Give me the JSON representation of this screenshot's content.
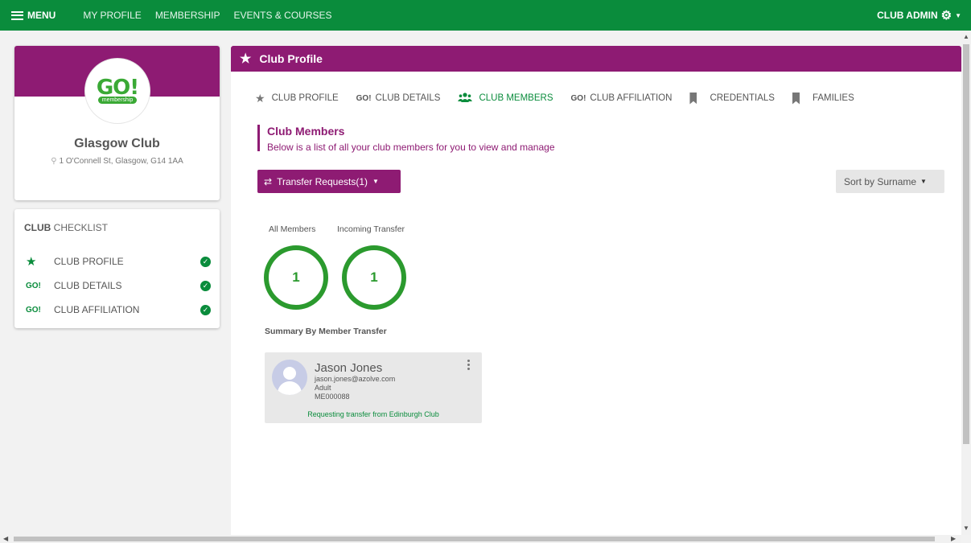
{
  "topnav": {
    "menu_label": "MENU",
    "links": [
      "MY PROFILE",
      "MEMBERSHIP",
      "EVENTS & COURSES"
    ],
    "user_label": "CLUB ADMIN"
  },
  "profile": {
    "logo_text": "GO!",
    "logo_sub": "membership",
    "club_name": "Glasgow Club",
    "address": "1 O'Connell St, Glasgow, G14 1AA"
  },
  "checklist": {
    "title_bold": "CLUB",
    "title_rest": " CHECKLIST",
    "items": [
      {
        "label": "CLUB PROFILE",
        "icon": "star-icon",
        "done": true
      },
      {
        "label": "CLUB DETAILS",
        "icon": "go-icon",
        "go_text": "GO!",
        "done": true
      },
      {
        "label": "CLUB AFFILIATION",
        "icon": "go-icon",
        "go_text": "GO!",
        "done": true
      }
    ]
  },
  "main": {
    "header_title": "Club Profile",
    "tabs": [
      {
        "label": "CLUB PROFILE",
        "icon": "star-icon"
      },
      {
        "label": "CLUB DETAILS",
        "icon": "go-icon",
        "go_text": "GO!"
      },
      {
        "label": "CLUB MEMBERS",
        "icon": "users-icon",
        "active": true
      },
      {
        "label": "CLUB AFFILIATION",
        "icon": "go-icon",
        "go_text": "GO!"
      },
      {
        "label": "CREDENTIALS",
        "icon": "bookmark-icon"
      },
      {
        "label": "FAMILIES",
        "icon": "bookmark-icon"
      }
    ],
    "section_title": "Club Members",
    "section_subtitle": "Below is a list of all your club members for you to view and manage",
    "transfer_button": "Transfer Requests(1)",
    "sort_button": "Sort by Surname",
    "stats": [
      {
        "label": "All Members",
        "value": "1"
      },
      {
        "label": "Incoming Transfer",
        "value": "1"
      }
    ],
    "summary_title": "Summary By Member Transfer",
    "member": {
      "name": "Jason Jones",
      "email": "jason.jones@azolve.com",
      "category": "Adult",
      "id": "ME000088",
      "status": "Requesting transfer from Edinburgh Club"
    }
  },
  "colors": {
    "nav_green": "#0a8c3c",
    "brand_purple": "#8e1b73",
    "ring_green": "#2b9a2e"
  }
}
